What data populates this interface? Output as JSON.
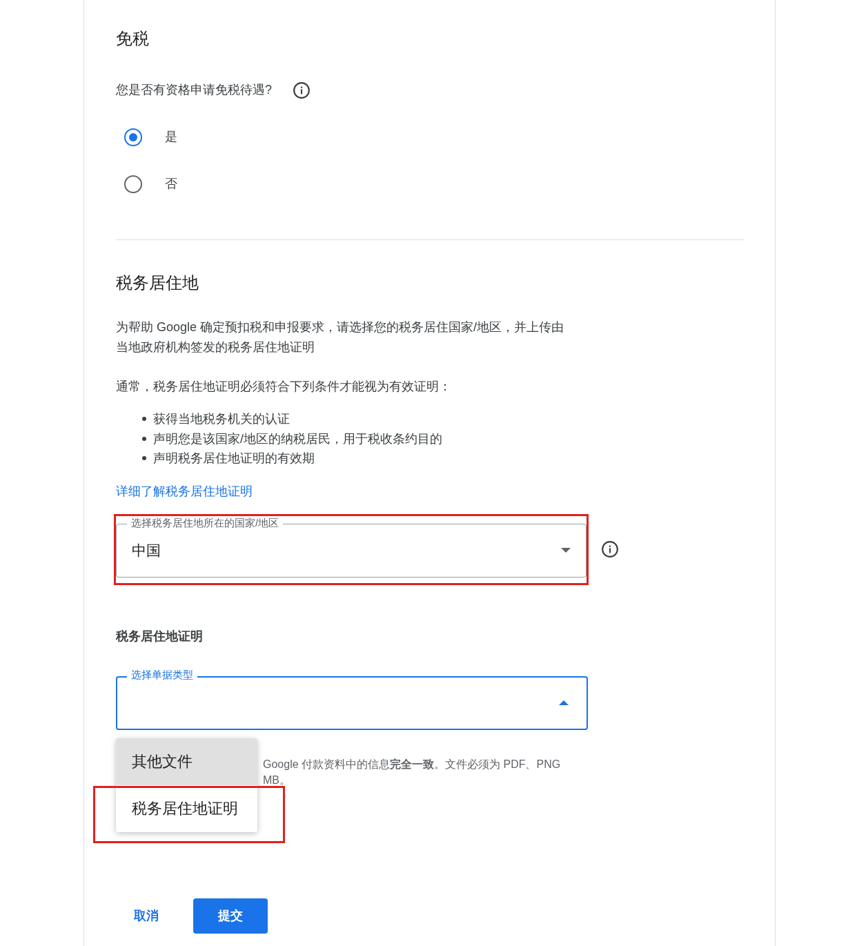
{
  "exemption": {
    "title": "免税",
    "question": "您是否有资格申请免税待遇?",
    "options": [
      {
        "label": "是",
        "selected": true
      },
      {
        "label": "否",
        "selected": false
      }
    ]
  },
  "residency": {
    "title": "税务居住地",
    "intro": "为帮助 Google 确定预扣税和申报要求，请选择您的税务居住国家/地区，并上传由当地政府机构签发的税务居住地证明",
    "conditions_intro": "通常，税务居住地证明必须符合下列条件才能视为有效证明：",
    "conditions": [
      "获得当地税务机关的认证",
      "声明您是该国家/地区的纳税居民，用于税收条约目的",
      "声明税务居住地证明的有效期"
    ],
    "link": "详细了解税务居住地证明",
    "country_select": {
      "label": "选择税务居住地所在的国家/地区",
      "value": "中国",
      "highlighted": true
    }
  },
  "certificate": {
    "title": "税务居住地证明",
    "type_select": {
      "label": "选择单据类型",
      "expanded": true
    },
    "menu": [
      {
        "label": "其他文件",
        "selected": true,
        "highlighted": false
      },
      {
        "label": "税务居住地证明",
        "selected": false,
        "highlighted": true
      }
    ],
    "hint_lines": [
      "Google 付款资料中的信息**完全一致**。文件必须为 PDF、PNG",
      "MB。"
    ]
  },
  "buttons": {
    "cancel": "取消",
    "submit": "提交"
  }
}
